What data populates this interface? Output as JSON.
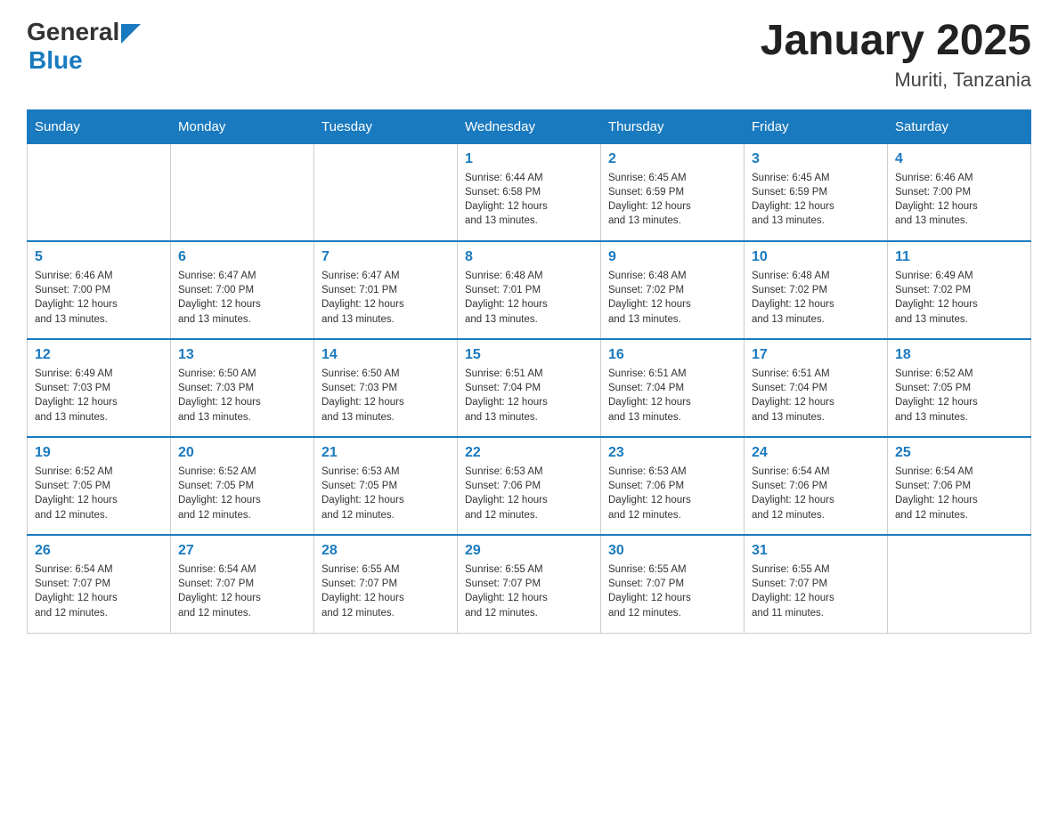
{
  "logo": {
    "general": "General",
    "blue": "Blue"
  },
  "title": "January 2025",
  "location": "Muriti, Tanzania",
  "headers": [
    "Sunday",
    "Monday",
    "Tuesday",
    "Wednesday",
    "Thursday",
    "Friday",
    "Saturday"
  ],
  "weeks": [
    [
      {
        "day": "",
        "info": ""
      },
      {
        "day": "",
        "info": ""
      },
      {
        "day": "",
        "info": ""
      },
      {
        "day": "1",
        "info": "Sunrise: 6:44 AM\nSunset: 6:58 PM\nDaylight: 12 hours\nand 13 minutes."
      },
      {
        "day": "2",
        "info": "Sunrise: 6:45 AM\nSunset: 6:59 PM\nDaylight: 12 hours\nand 13 minutes."
      },
      {
        "day": "3",
        "info": "Sunrise: 6:45 AM\nSunset: 6:59 PM\nDaylight: 12 hours\nand 13 minutes."
      },
      {
        "day": "4",
        "info": "Sunrise: 6:46 AM\nSunset: 7:00 PM\nDaylight: 12 hours\nand 13 minutes."
      }
    ],
    [
      {
        "day": "5",
        "info": "Sunrise: 6:46 AM\nSunset: 7:00 PM\nDaylight: 12 hours\nand 13 minutes."
      },
      {
        "day": "6",
        "info": "Sunrise: 6:47 AM\nSunset: 7:00 PM\nDaylight: 12 hours\nand 13 minutes."
      },
      {
        "day": "7",
        "info": "Sunrise: 6:47 AM\nSunset: 7:01 PM\nDaylight: 12 hours\nand 13 minutes."
      },
      {
        "day": "8",
        "info": "Sunrise: 6:48 AM\nSunset: 7:01 PM\nDaylight: 12 hours\nand 13 minutes."
      },
      {
        "day": "9",
        "info": "Sunrise: 6:48 AM\nSunset: 7:02 PM\nDaylight: 12 hours\nand 13 minutes."
      },
      {
        "day": "10",
        "info": "Sunrise: 6:48 AM\nSunset: 7:02 PM\nDaylight: 12 hours\nand 13 minutes."
      },
      {
        "day": "11",
        "info": "Sunrise: 6:49 AM\nSunset: 7:02 PM\nDaylight: 12 hours\nand 13 minutes."
      }
    ],
    [
      {
        "day": "12",
        "info": "Sunrise: 6:49 AM\nSunset: 7:03 PM\nDaylight: 12 hours\nand 13 minutes."
      },
      {
        "day": "13",
        "info": "Sunrise: 6:50 AM\nSunset: 7:03 PM\nDaylight: 12 hours\nand 13 minutes."
      },
      {
        "day": "14",
        "info": "Sunrise: 6:50 AM\nSunset: 7:03 PM\nDaylight: 12 hours\nand 13 minutes."
      },
      {
        "day": "15",
        "info": "Sunrise: 6:51 AM\nSunset: 7:04 PM\nDaylight: 12 hours\nand 13 minutes."
      },
      {
        "day": "16",
        "info": "Sunrise: 6:51 AM\nSunset: 7:04 PM\nDaylight: 12 hours\nand 13 minutes."
      },
      {
        "day": "17",
        "info": "Sunrise: 6:51 AM\nSunset: 7:04 PM\nDaylight: 12 hours\nand 13 minutes."
      },
      {
        "day": "18",
        "info": "Sunrise: 6:52 AM\nSunset: 7:05 PM\nDaylight: 12 hours\nand 13 minutes."
      }
    ],
    [
      {
        "day": "19",
        "info": "Sunrise: 6:52 AM\nSunset: 7:05 PM\nDaylight: 12 hours\nand 12 minutes."
      },
      {
        "day": "20",
        "info": "Sunrise: 6:52 AM\nSunset: 7:05 PM\nDaylight: 12 hours\nand 12 minutes."
      },
      {
        "day": "21",
        "info": "Sunrise: 6:53 AM\nSunset: 7:05 PM\nDaylight: 12 hours\nand 12 minutes."
      },
      {
        "day": "22",
        "info": "Sunrise: 6:53 AM\nSunset: 7:06 PM\nDaylight: 12 hours\nand 12 minutes."
      },
      {
        "day": "23",
        "info": "Sunrise: 6:53 AM\nSunset: 7:06 PM\nDaylight: 12 hours\nand 12 minutes."
      },
      {
        "day": "24",
        "info": "Sunrise: 6:54 AM\nSunset: 7:06 PM\nDaylight: 12 hours\nand 12 minutes."
      },
      {
        "day": "25",
        "info": "Sunrise: 6:54 AM\nSunset: 7:06 PM\nDaylight: 12 hours\nand 12 minutes."
      }
    ],
    [
      {
        "day": "26",
        "info": "Sunrise: 6:54 AM\nSunset: 7:07 PM\nDaylight: 12 hours\nand 12 minutes."
      },
      {
        "day": "27",
        "info": "Sunrise: 6:54 AM\nSunset: 7:07 PM\nDaylight: 12 hours\nand 12 minutes."
      },
      {
        "day": "28",
        "info": "Sunrise: 6:55 AM\nSunset: 7:07 PM\nDaylight: 12 hours\nand 12 minutes."
      },
      {
        "day": "29",
        "info": "Sunrise: 6:55 AM\nSunset: 7:07 PM\nDaylight: 12 hours\nand 12 minutes."
      },
      {
        "day": "30",
        "info": "Sunrise: 6:55 AM\nSunset: 7:07 PM\nDaylight: 12 hours\nand 12 minutes."
      },
      {
        "day": "31",
        "info": "Sunrise: 6:55 AM\nSunset: 7:07 PM\nDaylight: 12 hours\nand 11 minutes."
      },
      {
        "day": "",
        "info": ""
      }
    ]
  ]
}
